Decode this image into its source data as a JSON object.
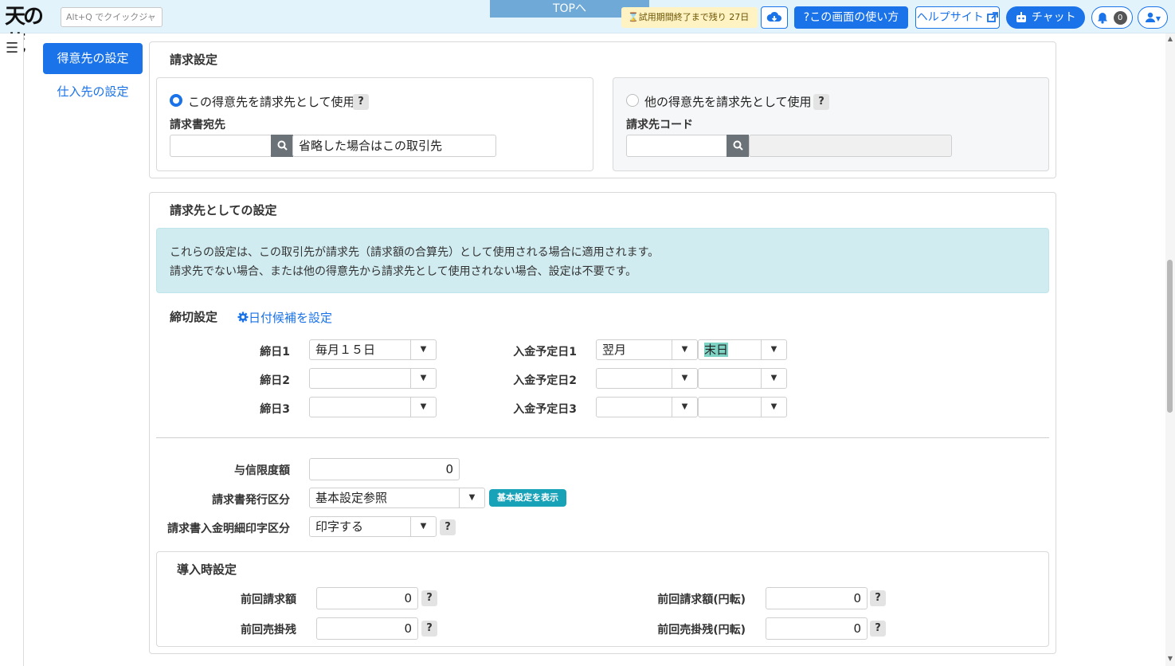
{
  "header": {
    "logo_text": "天の蔵",
    "quickjump_placeholder": "Alt+Q でクイックジャンプ",
    "top_link": "TOPへ",
    "trial_notice": "試用期間終了まで残り 27日",
    "howto_label": "この画面の使い方",
    "help_label": "ヘルプサイト",
    "chat_label": "チャット",
    "notification_count": "0"
  },
  "sidebar": {
    "items": [
      {
        "label": "得意先の設定",
        "active": true
      },
      {
        "label": "仕入先の設定",
        "active": false
      }
    ]
  },
  "billing": {
    "title": "請求設定",
    "option_self": {
      "label": "この得意先を請求先として使用",
      "selected": true,
      "field_label": "請求書宛先",
      "code_value": "",
      "name_value": "省略した場合はこの取引先"
    },
    "option_other": {
      "label": "他の得意先を請求先として使用",
      "selected": false,
      "field_label": "請求先コード",
      "code_value": "",
      "name_value": ""
    }
  },
  "billto": {
    "title": "請求先としての設定",
    "info_line1": "これらの設定は、この取引先が請求先（請求額の合算先）として使用される場合に適用されます。",
    "info_line2": "請求先でない場合、または他の得意先から請求先として使用されない場合、設定は不要です。",
    "closing_title": "締切設定",
    "date_candidates_link": "日付候補を設定",
    "closing_days": [
      {
        "label": "締日1",
        "value": "毎月１５日"
      },
      {
        "label": "締日2",
        "value": ""
      },
      {
        "label": "締日3",
        "value": ""
      }
    ],
    "payment_days": [
      {
        "label": "入金予定日1",
        "month": "翌月",
        "day": "末日"
      },
      {
        "label": "入金予定日2",
        "month": "",
        "day": ""
      },
      {
        "label": "入金予定日3",
        "month": "",
        "day": ""
      }
    ],
    "credit_limit_label": "与信限度額",
    "credit_limit_value": "0",
    "invoice_issue_label": "請求書発行区分",
    "invoice_issue_value": "基本設定参照",
    "show_basic_label": "基本設定を表示",
    "payment_detail_label": "請求書入金明細印字区分",
    "payment_detail_value": "印字する",
    "intro": {
      "title": "導入時設定",
      "prev_invoice_label": "前回請求額",
      "prev_invoice_value": "0",
      "prev_receivable_label": "前回売掛残",
      "prev_receivable_value": "0",
      "prev_invoice_yen_label": "前回請求額(円転)",
      "prev_invoice_yen_value": "0",
      "prev_receivable_yen_label": "前回売掛残(円転)",
      "prev_receivable_yen_value": "0"
    }
  },
  "icons": {
    "download": "cloud-download-icon",
    "help": "external-link-icon",
    "chat": "robot-icon",
    "bell": "bell-icon",
    "user": "user-icon",
    "search": "search-icon",
    "gear": "gear-icon",
    "menu": "hamburger-icon"
  },
  "colors": {
    "primary": "#1a73e8",
    "info_bg": "#d1ecf1",
    "teal_badge": "#17a2b8",
    "header_bg": "#e3f3fc"
  }
}
